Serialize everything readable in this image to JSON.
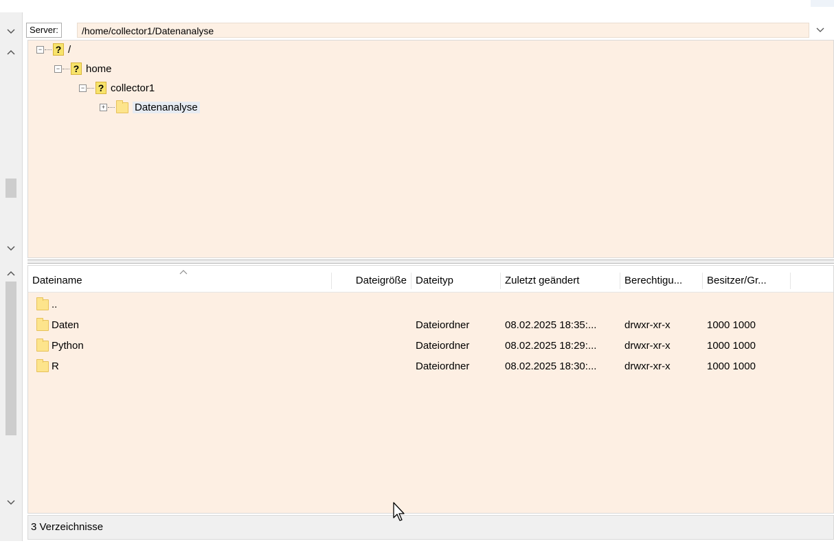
{
  "server_bar": {
    "label": "Server:",
    "path": "/home/collector1/Datenanalyse"
  },
  "tree": {
    "nodes": [
      {
        "label": "/",
        "icon": "question-icon"
      },
      {
        "label": "home",
        "icon": "question-icon"
      },
      {
        "label": "collector1",
        "icon": "question-icon"
      },
      {
        "label": "Datenanalyse",
        "icon": "folder-icon",
        "selected": true
      }
    ]
  },
  "file_list": {
    "columns": [
      "Dateiname",
      "Dateigröße",
      "Dateityp",
      "Zuletzt geändert",
      "Berechtigu...",
      "Besitzer/Gr..."
    ],
    "rows": [
      {
        "name": "..",
        "size": "",
        "type": "",
        "modified": "",
        "permissions": "",
        "owner": ""
      },
      {
        "name": "Daten",
        "size": "",
        "type": "Dateiordner",
        "modified": "08.02.2025 18:35:...",
        "permissions": "drwxr-xr-x",
        "owner": "1000 1000"
      },
      {
        "name": "Python",
        "size": "",
        "type": "Dateiordner",
        "modified": "08.02.2025 18:29:...",
        "permissions": "drwxr-xr-x",
        "owner": "1000 1000"
      },
      {
        "name": "R",
        "size": "",
        "type": "Dateiordner",
        "modified": "08.02.2025 18:30:...",
        "permissions": "drwxr-xr-x",
        "owner": "1000 1000"
      }
    ]
  },
  "status_bar": {
    "text": "3 Verzeichnisse"
  },
  "colors": {
    "pane_background": "#fdefe3",
    "folder_fill": "#fde48c",
    "question_icon": "#f7e36b"
  }
}
